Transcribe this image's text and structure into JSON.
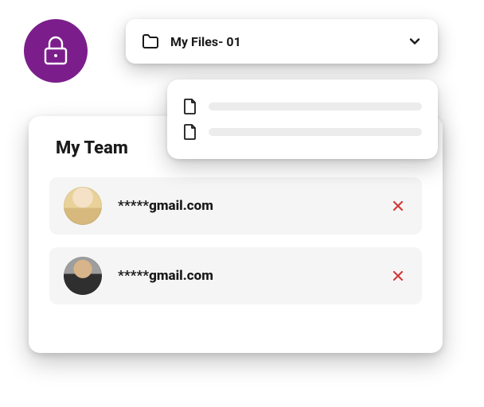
{
  "colors": {
    "accent": "#7b1e8b",
    "danger": "#d23b3b"
  },
  "folder_select": {
    "label": "My Files- 01"
  },
  "dropdown": {
    "items": [
      {},
      {}
    ]
  },
  "team": {
    "title": "My Team",
    "members": [
      {
        "email": "*****gmail.com"
      },
      {
        "email": "*****gmail.com"
      }
    ]
  }
}
